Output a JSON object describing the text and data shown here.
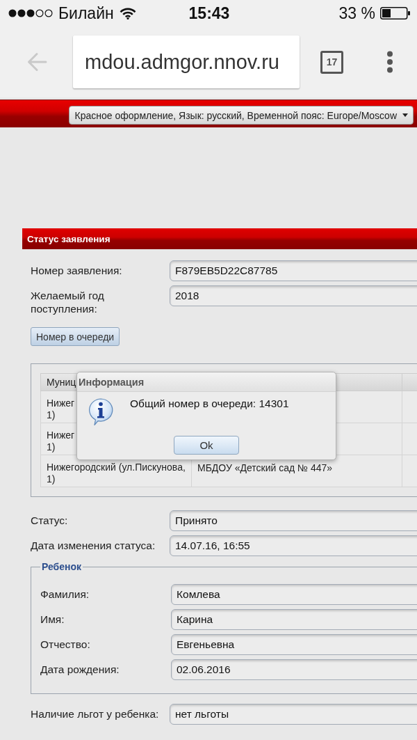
{
  "status_bar": {
    "carrier": "Билайн",
    "time": "15:43",
    "battery": "33 %"
  },
  "browser": {
    "back_button": {
      "disabled": true
    },
    "url": "mdou.admgor.nnov.ru",
    "tab_count": "17"
  },
  "header": {
    "preferences": "Красное оформление, Язык: русский, Временной пояс: Europe/Moscow"
  },
  "panel": {
    "title": "Статус заявления",
    "fields": [
      {
        "label": "Номер заявления:",
        "value": "F879EB5D22C87785"
      },
      {
        "label": "Желаемый год поступления:",
        "value": "2018"
      }
    ],
    "queue_button": "Номер в очереди",
    "table": {
      "columns": [
        "Муниц"
      ],
      "rows": [
        {
          "cells": [
            {
              "lines": [
                "Нижег",
                "1)"
              ]
            }
          ]
        },
        {
          "cells": [
            {
              "lines": [
                "Нижег",
                "1)"
              ]
            }
          ]
        },
        {
          "cells": [
            {
              "lines": [
                "Нижегородский (ул.Пискунова,",
                "1)"
              ]
            },
            {
              "lines": [
                "МБДОУ «Детский сад № 447»"
              ]
            }
          ]
        }
      ]
    },
    "status_fields": [
      {
        "label": "Статус:",
        "value": "Принято"
      },
      {
        "label": "Дата изменения статуса:",
        "value": "14.07.16, 16:55"
      }
    ],
    "child": {
      "legend": "Ребенок",
      "fields": [
        {
          "label": "Фамилия:",
          "value": "Комлева"
        },
        {
          "label": "Имя:",
          "value": "Карина"
        },
        {
          "label": "Отчество:",
          "value": "Евгеньевна"
        },
        {
          "label": "Дата рождения:",
          "value": "02.06.2016"
        }
      ]
    },
    "benefits": {
      "label": "Наличие льгот у ребенка:",
      "value": "нет льготы"
    }
  },
  "dialog": {
    "title": "Информация",
    "message": "Общий номер в очереди: 14301",
    "button": "Ok"
  }
}
